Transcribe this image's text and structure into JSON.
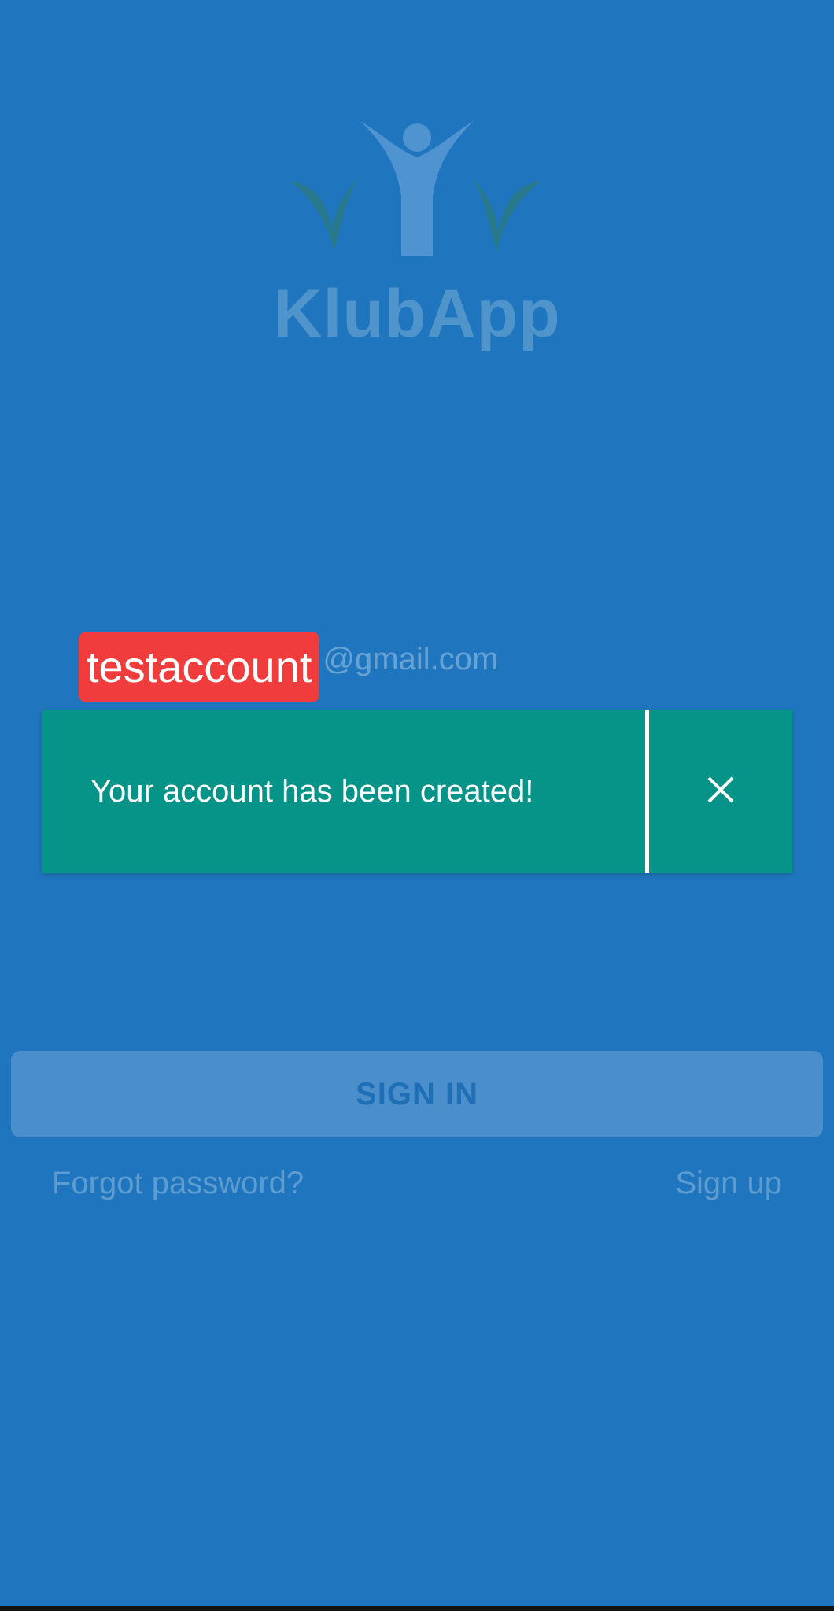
{
  "brand": {
    "name": "KlubApp"
  },
  "login": {
    "email_username": "testaccount",
    "email_domain": "@gmail.com",
    "sign_in_label": "SIGN IN",
    "forgot_password_label": "Forgot password?",
    "sign_up_label": "Sign up"
  },
  "toast": {
    "message": "Your account has been created!",
    "close_icon": "close-icon"
  },
  "colors": {
    "background": "#1f76be",
    "toast": "#069388",
    "highlight": "#f03c3c",
    "button": "#4a8fcc"
  },
  "icons": {
    "logo": "klubapp-logo-icon",
    "close": "close-icon"
  }
}
